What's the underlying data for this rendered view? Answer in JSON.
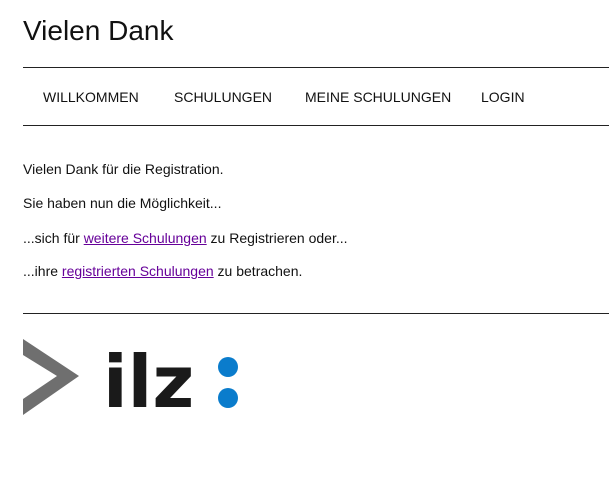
{
  "header": {
    "title": "Vielen Dank"
  },
  "nav": {
    "items": [
      {
        "label": "WILLKOMMEN"
      },
      {
        "label": "SCHULUNGEN"
      },
      {
        "label": "MEINE SCHULUNGEN"
      },
      {
        "label": "LOGIN"
      }
    ]
  },
  "content": {
    "line1": "Vielen Dank für die Registration.",
    "line2": "Sie haben nun die Möglichkeit...",
    "line3": {
      "before": "...sich für ",
      "link": "weitere Schulungen",
      "after": " zu Registrieren oder..."
    },
    "line4": {
      "before": "...ihre ",
      "link": "registrierten Schulungen",
      "after": " zu betrachen."
    }
  },
  "footer": {
    "logo_text": "ilz"
  },
  "colors": {
    "text": "#111111",
    "link_visited": "#660099",
    "logo_arrow": "#6f6f6f",
    "logo_text": "#1a1a1a",
    "logo_dots": "#0a7ccc"
  }
}
